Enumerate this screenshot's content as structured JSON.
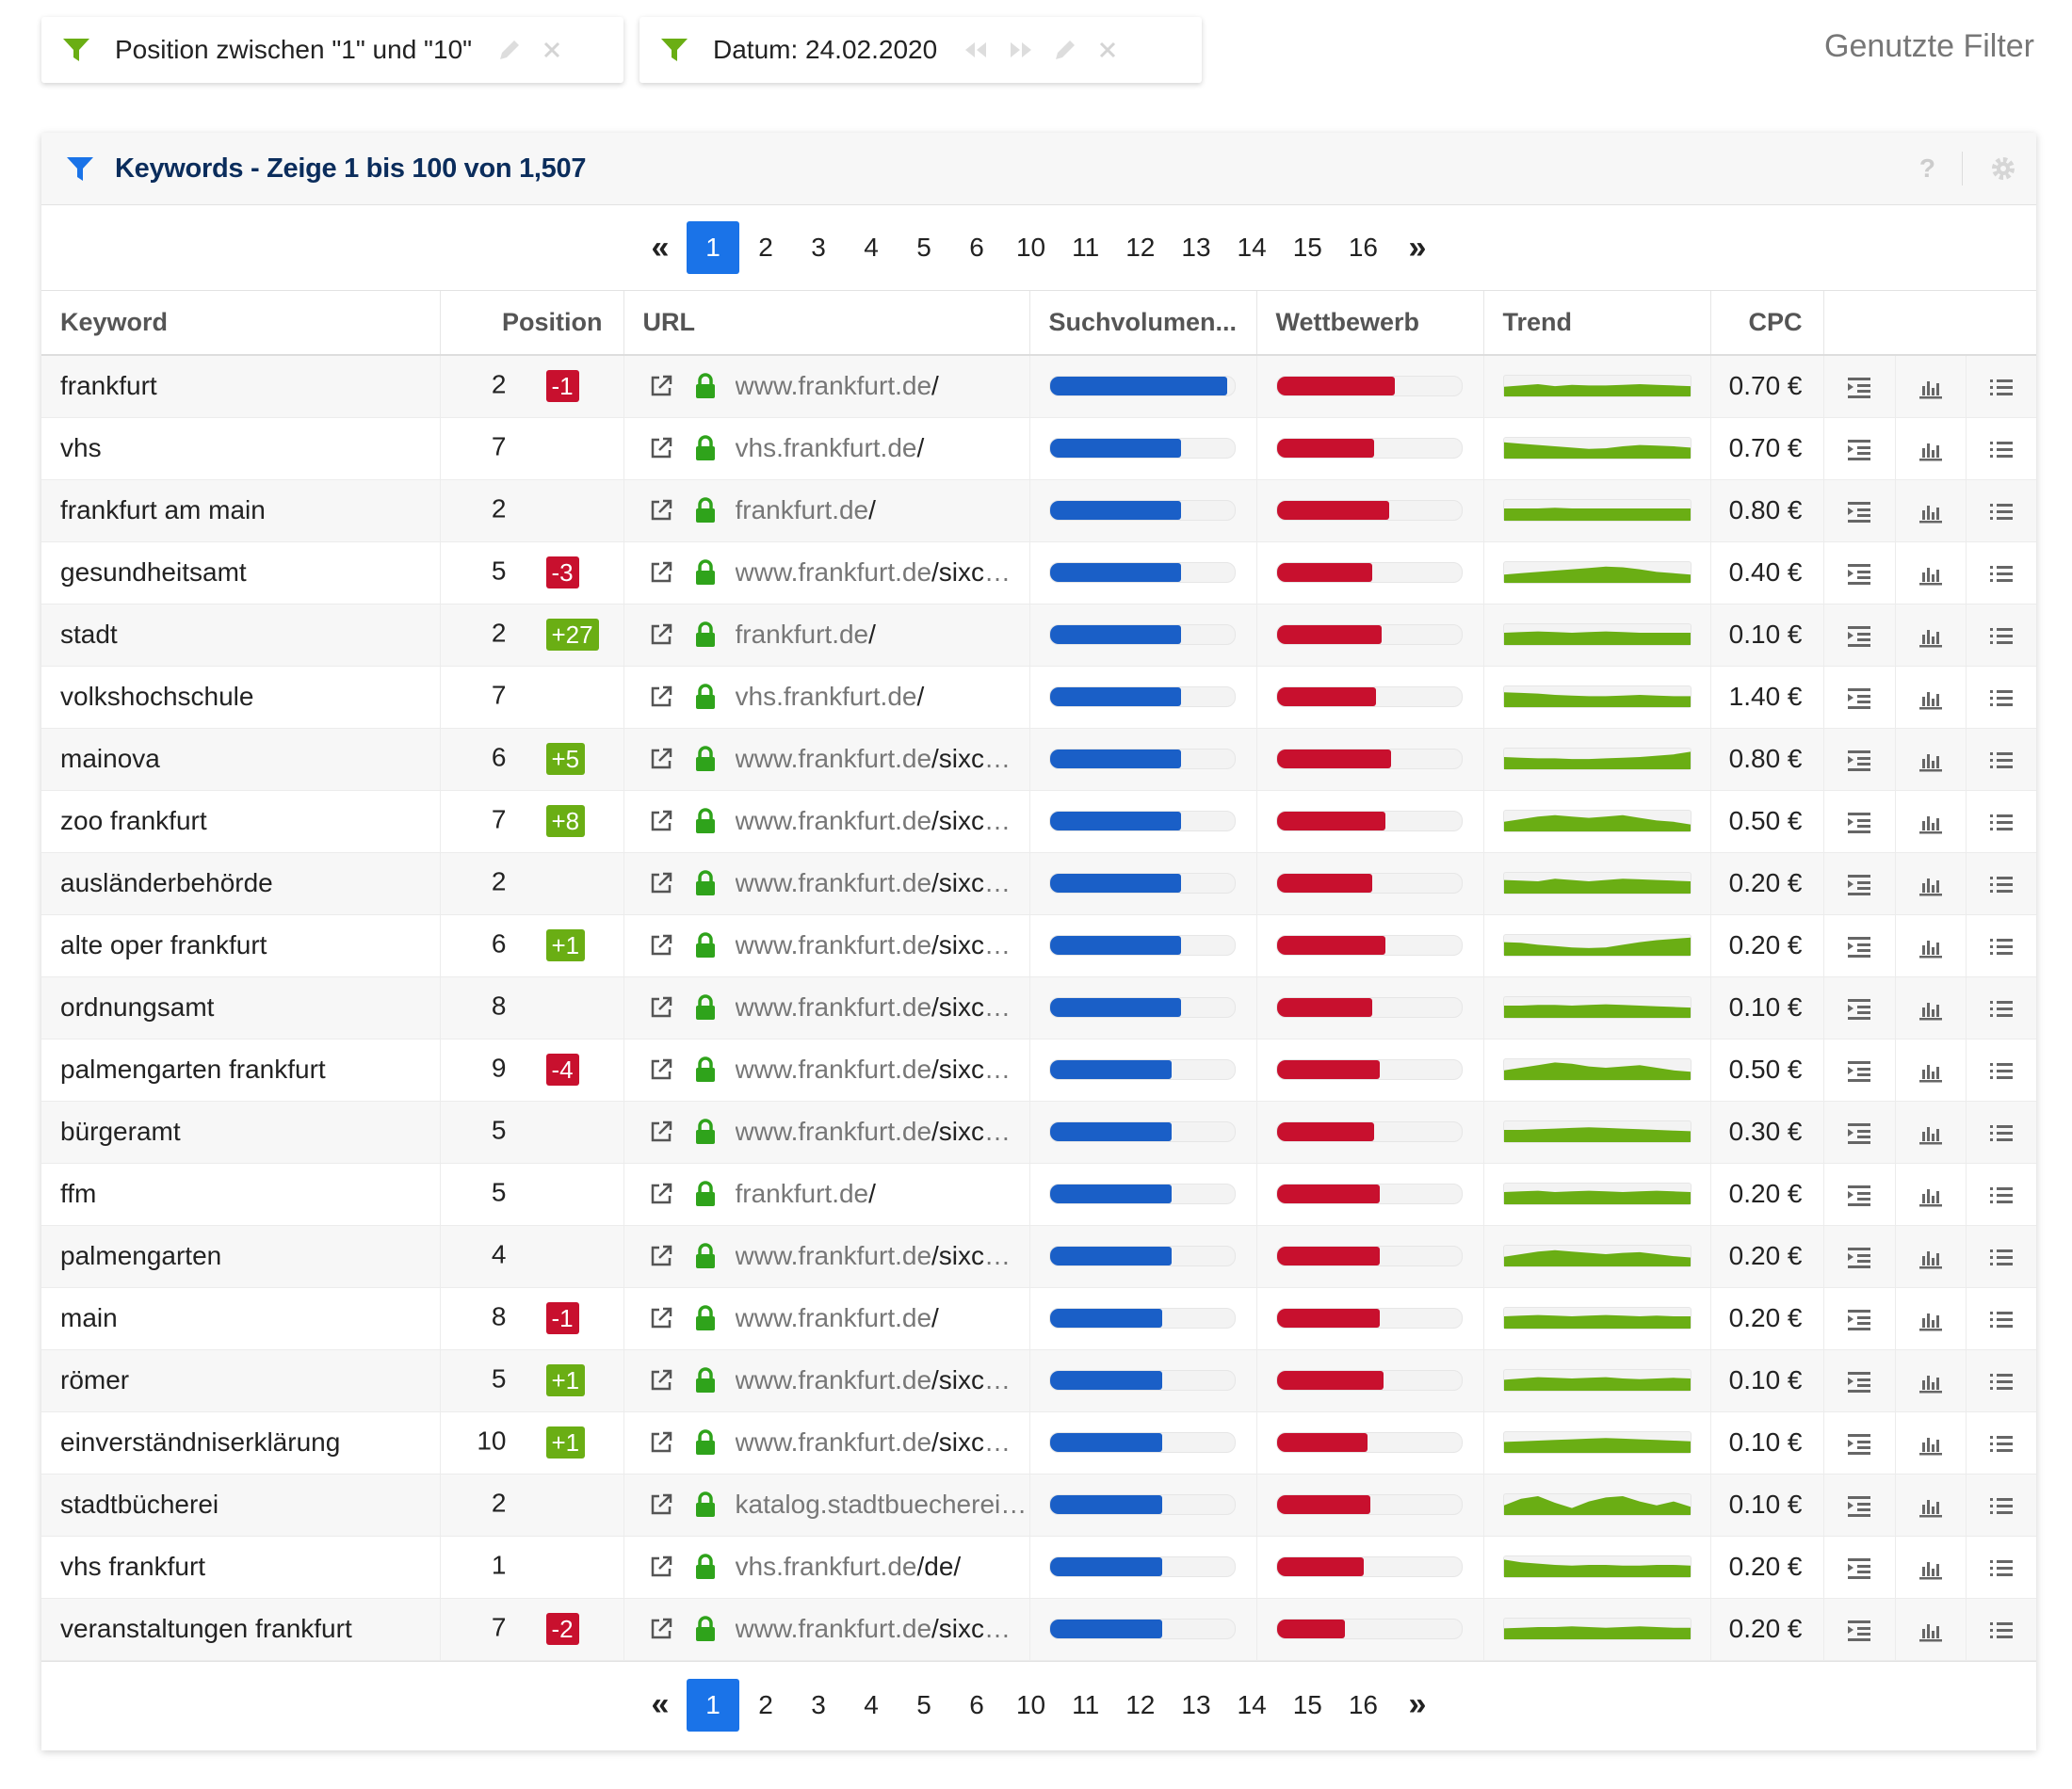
{
  "filters": [
    {
      "label": "Position zwischen \"1\" und \"10\"",
      "has_nav": false
    },
    {
      "label": "Datum: 24.02.2020",
      "has_nav": true
    }
  ],
  "used_filters_label": "Genutzte Filter",
  "card": {
    "title": "Keywords - Zeige 1 bis 100 von 1,507",
    "help": "?"
  },
  "pagination": {
    "first": "«",
    "last": "»",
    "pages": [
      "1",
      "2",
      "3",
      "4",
      "5",
      "6",
      "10",
      "11",
      "12",
      "13",
      "14",
      "15",
      "16"
    ],
    "active": "1"
  },
  "columns": {
    "keyword": "Keyword",
    "position": "Position",
    "url": "URL",
    "search_volume": "Suchvolumen...",
    "competition": "Wettbewerb",
    "trend": "Trend",
    "cpc": "CPC"
  },
  "colors": {
    "accent": "#1a73e8",
    "volume_bar": "#1a5fc7",
    "competition_bar": "#c8102e",
    "trend": "#6aae14",
    "badge_up": "#6aae14",
    "badge_down": "#c8102e",
    "lock": "#2fa31b"
  },
  "rows": [
    {
      "keyword": "frankfurt",
      "position": "2",
      "change": "-1",
      "url_host": "www.frankfurt.de",
      "url_path": "/",
      "volume": 0.96,
      "competition": 0.64,
      "trend": [
        0.3,
        0.4,
        0.5,
        0.35,
        0.45,
        0.4,
        0.4,
        0.45,
        0.5,
        0.45,
        0.4,
        0.35
      ],
      "cpc": "0.70 €"
    },
    {
      "keyword": "vhs",
      "position": "7",
      "change": "",
      "url_host": "vhs.frankfurt.de",
      "url_path": "/",
      "volume": 0.71,
      "competition": 0.53,
      "trend": [
        0.8,
        0.7,
        0.6,
        0.5,
        0.4,
        0.3,
        0.35,
        0.5,
        0.6,
        0.55,
        0.5,
        0.4
      ],
      "cpc": "0.70 €"
    },
    {
      "keyword": "frankfurt am main",
      "position": "2",
      "change": "",
      "url_host": "frankfurt.de",
      "url_path": "/",
      "volume": 0.71,
      "competition": 0.61,
      "trend": [
        0.5,
        0.5,
        0.5,
        0.55,
        0.5,
        0.5,
        0.5,
        0.5,
        0.5,
        0.5,
        0.5,
        0.5
      ],
      "cpc": "0.80 €"
    },
    {
      "keyword": "gesundheitsamt",
      "position": "5",
      "change": "-3",
      "url_host": "www.frankfurt.de",
      "url_path": "/sixcms/detail.php",
      "volume": 0.71,
      "competition": 0.52,
      "trend": [
        0.2,
        0.3,
        0.4,
        0.5,
        0.6,
        0.7,
        0.8,
        0.75,
        0.6,
        0.4,
        0.3,
        0.2
      ],
      "cpc": "0.40 €"
    },
    {
      "keyword": "stadt",
      "position": "2",
      "change": "+27",
      "url_host": "frankfurt.de",
      "url_path": "/",
      "volume": 0.71,
      "competition": 0.57,
      "trend": [
        0.5,
        0.55,
        0.6,
        0.55,
        0.5,
        0.55,
        0.6,
        0.55,
        0.5,
        0.5,
        0.5,
        0.5
      ],
      "cpc": "0.10 €"
    },
    {
      "keyword": "volkshochschule",
      "position": "7",
      "change": "",
      "url_host": "vhs.frankfurt.de",
      "url_path": "/",
      "volume": 0.71,
      "competition": 0.54,
      "trend": [
        0.7,
        0.65,
        0.6,
        0.5,
        0.45,
        0.4,
        0.4,
        0.45,
        0.5,
        0.45,
        0.4,
        0.4
      ],
      "cpc": "1.40 €"
    },
    {
      "keyword": "mainova",
      "position": "6",
      "change": "+5",
      "url_host": "www.frankfurt.de",
      "url_path": "/sixcms/detail.php",
      "volume": 0.71,
      "competition": 0.62,
      "trend": [
        0.5,
        0.45,
        0.4,
        0.4,
        0.35,
        0.35,
        0.4,
        0.45,
        0.5,
        0.6,
        0.7,
        0.9
      ],
      "cpc": "0.80 €"
    },
    {
      "keyword": "zoo frankfurt",
      "position": "7",
      "change": "+8",
      "url_host": "www.frankfurt.de",
      "url_path": "/sixcms/detail.php",
      "volume": 0.71,
      "competition": 0.59,
      "trend": [
        0.3,
        0.5,
        0.7,
        0.8,
        0.7,
        0.6,
        0.7,
        0.8,
        0.6,
        0.4,
        0.3,
        0.1
      ],
      "cpc": "0.50 €"
    },
    {
      "keyword": "ausländerbehörde",
      "position": "2",
      "change": "",
      "url_host": "www.frankfurt.de",
      "url_path": "/sixcms/detail.php",
      "volume": 0.71,
      "competition": 0.52,
      "trend": [
        0.6,
        0.55,
        0.5,
        0.7,
        0.6,
        0.5,
        0.6,
        0.7,
        0.65,
        0.6,
        0.55,
        0.5
      ],
      "cpc": "0.20 €"
    },
    {
      "keyword": "alte oper frankfurt",
      "position": "6",
      "change": "+1",
      "url_host": "www.frankfurt.de",
      "url_path": "/sixcms/detail.php",
      "volume": 0.71,
      "competition": 0.59,
      "trend": [
        0.6,
        0.55,
        0.4,
        0.3,
        0.2,
        0.15,
        0.2,
        0.4,
        0.6,
        0.75,
        0.85,
        0.95
      ],
      "cpc": "0.20 €"
    },
    {
      "keyword": "ordnungsamt",
      "position": "8",
      "change": "",
      "url_host": "www.frankfurt.de",
      "url_path": "/sixcms/detail.php",
      "volume": 0.71,
      "competition": 0.52,
      "trend": [
        0.5,
        0.5,
        0.55,
        0.55,
        0.5,
        0.55,
        0.6,
        0.55,
        0.5,
        0.45,
        0.4,
        0.35
      ],
      "cpc": "0.10 €"
    },
    {
      "keyword": "palmengarten frankfurt",
      "position": "9",
      "change": "-4",
      "url_host": "www.frankfurt.de",
      "url_path": "/sixcms/detail.php",
      "volume": 0.66,
      "competition": 0.56,
      "trend": [
        0.3,
        0.5,
        0.7,
        0.9,
        0.8,
        0.6,
        0.5,
        0.6,
        0.7,
        0.5,
        0.3,
        0.2
      ],
      "cpc": "0.50 €"
    },
    {
      "keyword": "bürgeramt",
      "position": "5",
      "change": "",
      "url_host": "www.frankfurt.de",
      "url_path": "/sixcms/detail.php",
      "volume": 0.66,
      "competition": 0.53,
      "trend": [
        0.5,
        0.5,
        0.55,
        0.6,
        0.65,
        0.7,
        0.65,
        0.6,
        0.55,
        0.5,
        0.45,
        0.4
      ],
      "cpc": "0.30 €"
    },
    {
      "keyword": "ffm",
      "position": "5",
      "change": "",
      "url_host": "frankfurt.de",
      "url_path": "/",
      "volume": 0.66,
      "competition": 0.56,
      "trend": [
        0.5,
        0.55,
        0.6,
        0.5,
        0.55,
        0.6,
        0.55,
        0.5,
        0.55,
        0.6,
        0.55,
        0.5
      ],
      "cpc": "0.20 €"
    },
    {
      "keyword": "palmengarten",
      "position": "4",
      "change": "",
      "url_host": "www.frankfurt.de",
      "url_path": "/sixcms/detail.php",
      "volume": 0.66,
      "competition": 0.56,
      "trend": [
        0.3,
        0.5,
        0.7,
        0.8,
        0.7,
        0.6,
        0.5,
        0.6,
        0.65,
        0.5,
        0.35,
        0.25
      ],
      "cpc": "0.20 €"
    },
    {
      "keyword": "main",
      "position": "8",
      "change": "-1",
      "url_host": "www.frankfurt.de",
      "url_path": "/",
      "volume": 0.61,
      "competition": 0.56,
      "trend": [
        0.5,
        0.55,
        0.6,
        0.55,
        0.5,
        0.55,
        0.6,
        0.55,
        0.5,
        0.55,
        0.5,
        0.5
      ],
      "cpc": "0.20 €"
    },
    {
      "keyword": "römer",
      "position": "5",
      "change": "+1",
      "url_host": "www.frankfurt.de",
      "url_path": "/sixcms/detail.php",
      "volume": 0.61,
      "competition": 0.58,
      "trend": [
        0.4,
        0.5,
        0.6,
        0.55,
        0.5,
        0.55,
        0.6,
        0.5,
        0.45,
        0.5,
        0.55,
        0.5
      ],
      "cpc": "0.10 €"
    },
    {
      "keyword": "einverständniserklärung",
      "position": "10",
      "change": "+1",
      "url_host": "www.frankfurt.de",
      "url_path": "/sixcms/detail.php",
      "volume": 0.61,
      "competition": 0.49,
      "trend": [
        0.4,
        0.45,
        0.5,
        0.55,
        0.6,
        0.65,
        0.7,
        0.65,
        0.6,
        0.55,
        0.5,
        0.45
      ],
      "cpc": "0.10 €"
    },
    {
      "keyword": "stadtbücherei",
      "position": "2",
      "change": "",
      "url_host": "katalog.stadtbuecherei.frankfurt.de",
      "url_path": "/",
      "volume": 0.61,
      "competition": 0.51,
      "trend": [
        0.3,
        0.8,
        1.0,
        0.5,
        0.1,
        0.6,
        0.9,
        1.0,
        0.6,
        0.3,
        0.6,
        0.2
      ],
      "cpc": "0.10 €"
    },
    {
      "keyword": "vhs frankfurt",
      "position": "1",
      "change": "",
      "url_host": "vhs.frankfurt.de",
      "url_path": "/de/",
      "volume": 0.61,
      "competition": 0.47,
      "trend": [
        0.9,
        0.7,
        0.6,
        0.5,
        0.45,
        0.5,
        0.5,
        0.45,
        0.45,
        0.5,
        0.5,
        0.45
      ],
      "cpc": "0.20 €"
    },
    {
      "keyword": "veranstaltungen frankfurt",
      "position": "7",
      "change": "-2",
      "url_host": "www.frankfurt.de",
      "url_path": "/sixcms/detail.php",
      "volume": 0.61,
      "competition": 0.37,
      "trend": [
        0.4,
        0.45,
        0.5,
        0.5,
        0.55,
        0.5,
        0.45,
        0.5,
        0.55,
        0.5,
        0.45,
        0.45
      ],
      "cpc": "0.20 €"
    }
  ]
}
